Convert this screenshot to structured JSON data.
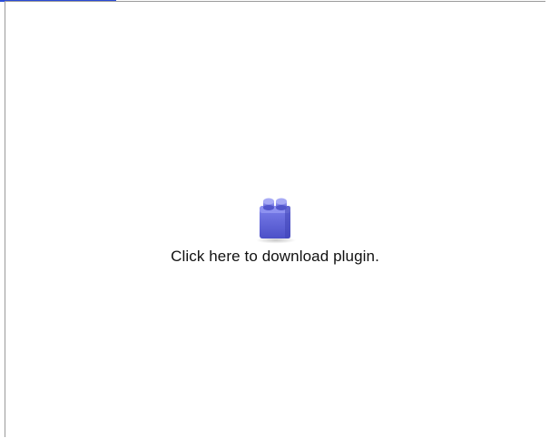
{
  "plugin": {
    "message": "Click here to download plugin.",
    "icon": "lego-brick-plugin-icon",
    "icon_color": "#5a5fd6"
  },
  "colors": {
    "link_blue": "#2a4bd7",
    "frame_border": "#9a9a9a",
    "background": "#ffffff"
  }
}
